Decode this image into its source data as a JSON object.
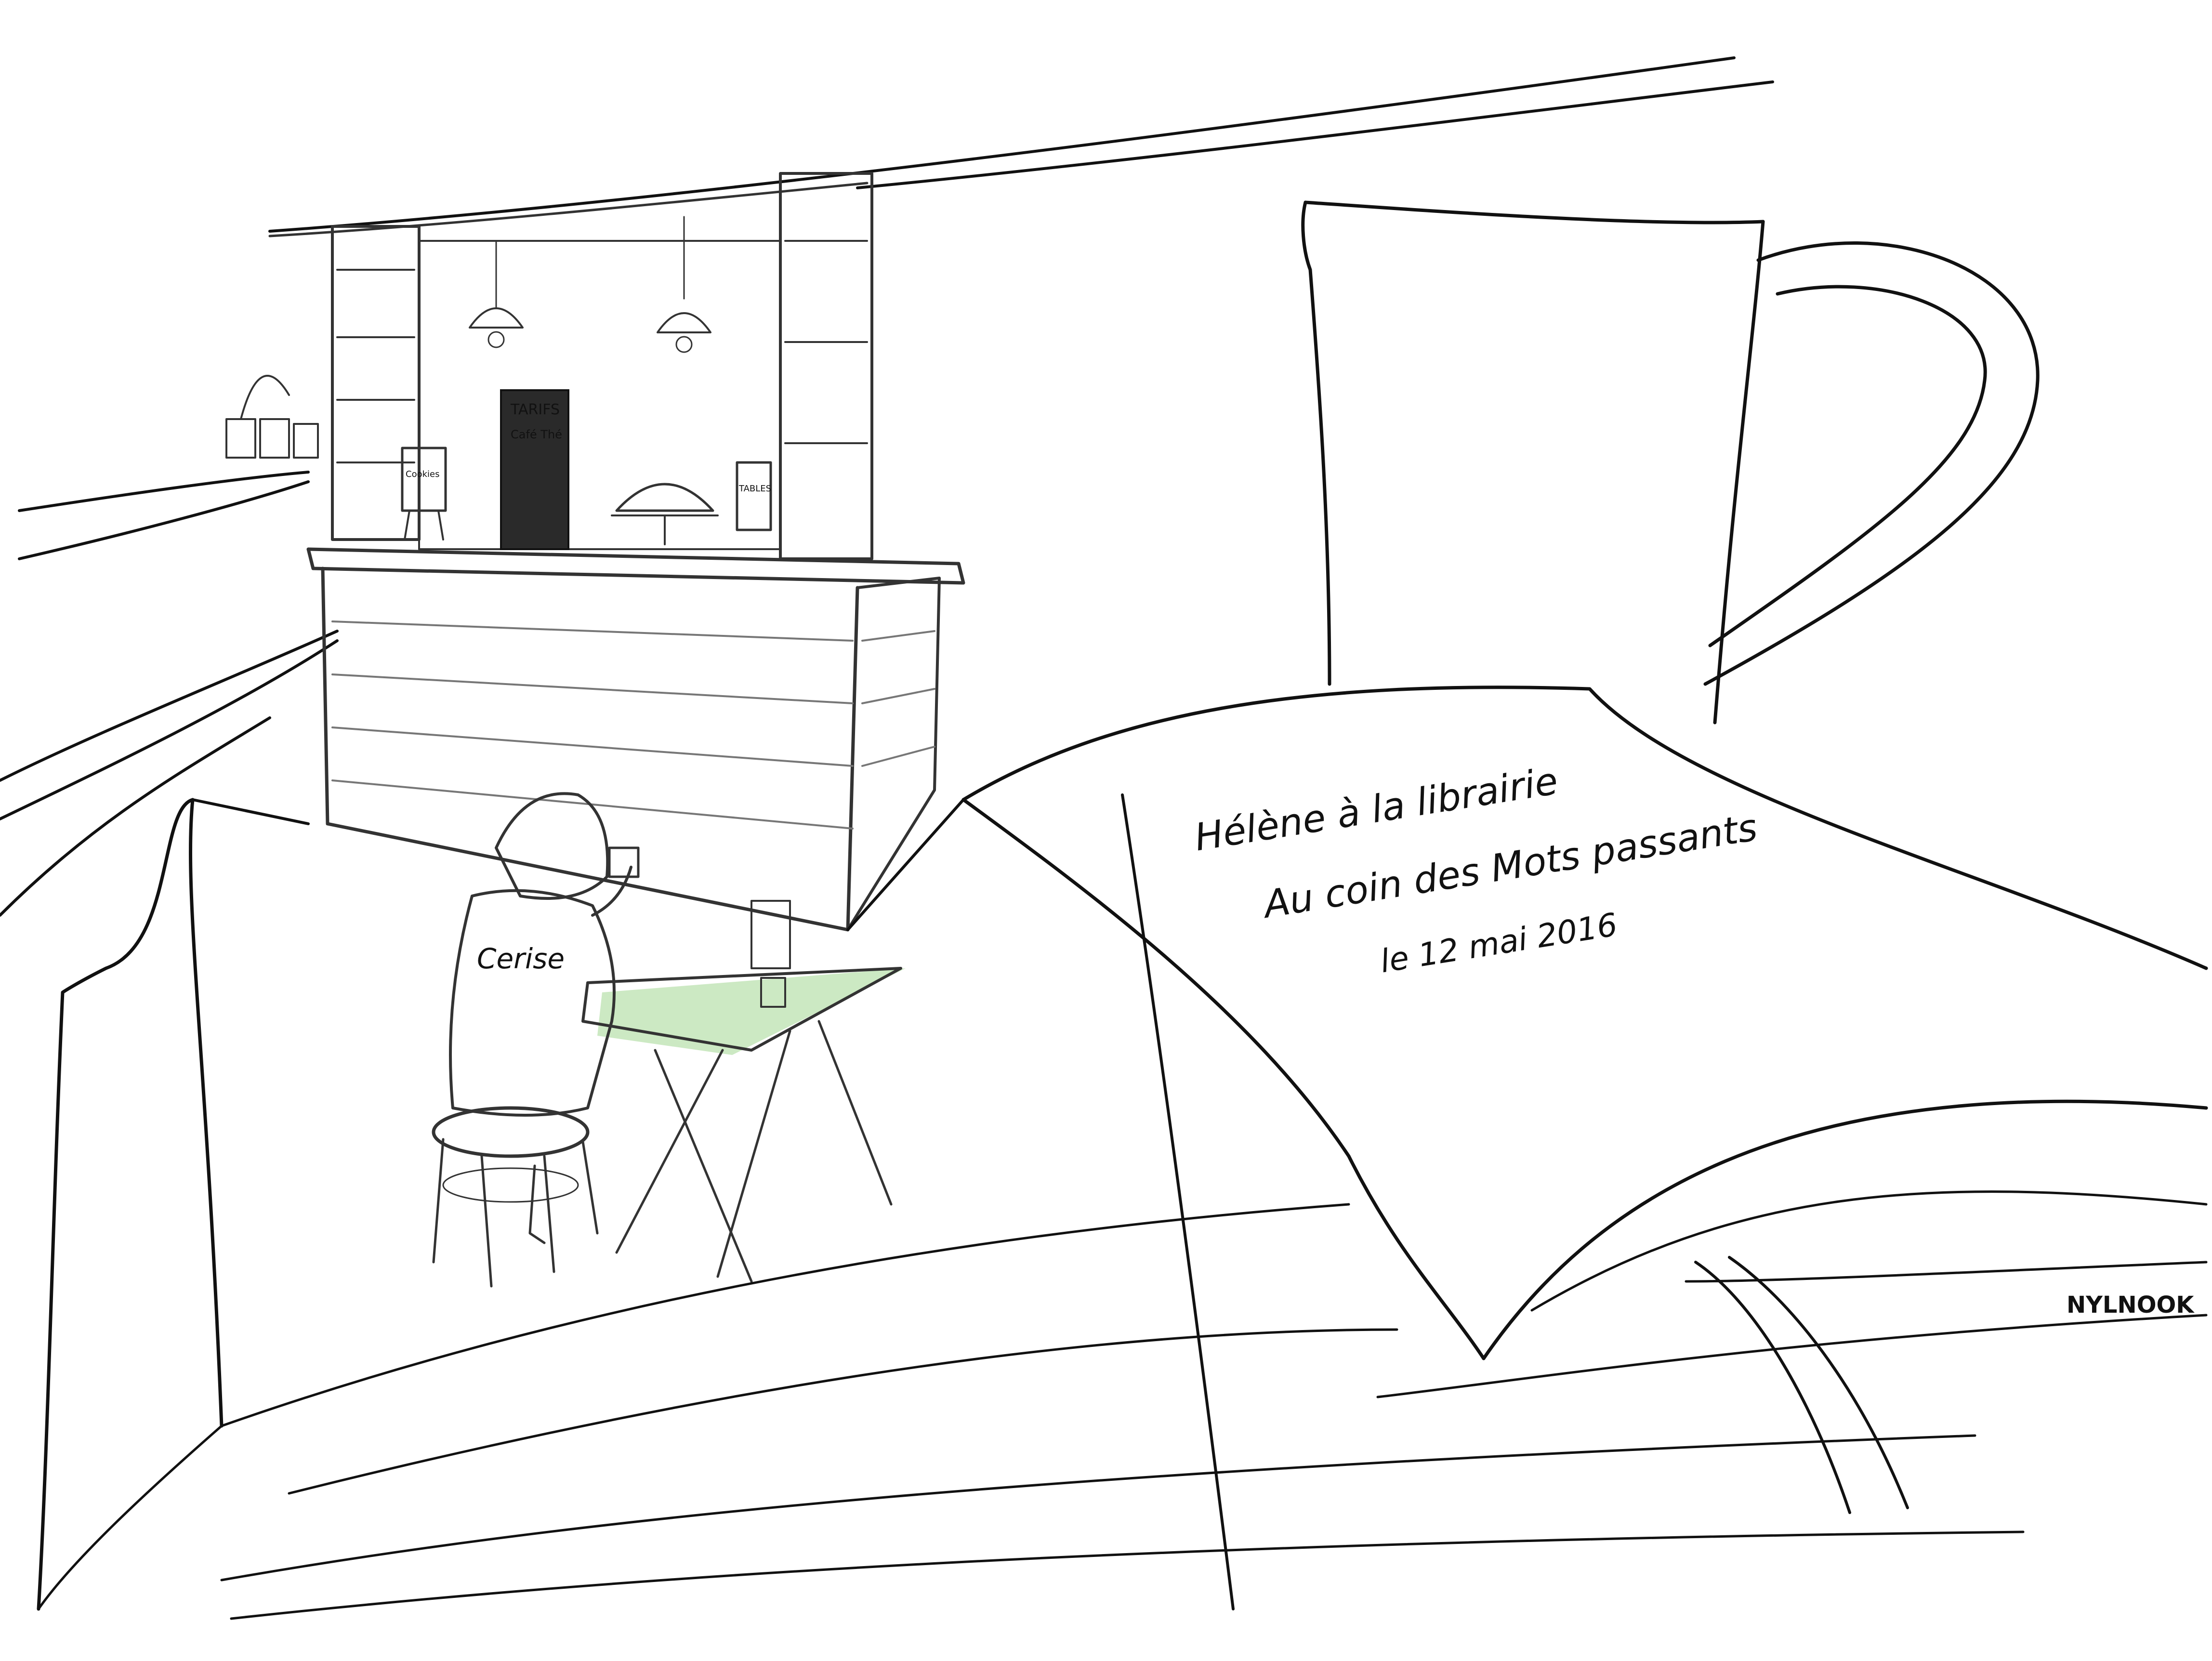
{
  "book_page": {
    "line1": "Hélène à la librairie",
    "line2": "Au coin des Mots passants",
    "line3": "le 12 mai 2016"
  },
  "signature": "NYLNOOK",
  "jacket_text": "Cerise",
  "shop_signs": {
    "door_sign": "TARIFS",
    "door_sign_sub": "Café Thé",
    "easel": "Cookies",
    "side_sign": "TABLES"
  },
  "colors": {
    "ink": "#111111",
    "pencil": "#333333",
    "green_wash": "#8fcf7a",
    "paper": "#ffffff"
  }
}
